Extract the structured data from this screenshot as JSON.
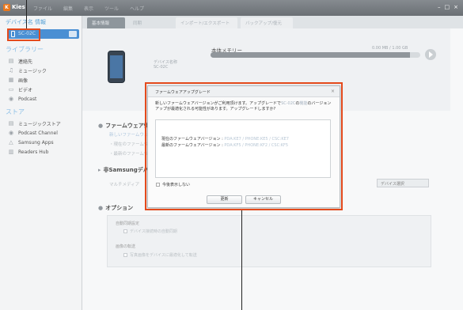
{
  "window": {
    "app_name": "Kies",
    "logo_letter": "K",
    "menu": [
      "ファイル",
      "編集",
      "表示",
      "ツール",
      "ヘルプ"
    ],
    "controls": [
      "–",
      "□",
      "×"
    ]
  },
  "sidebar": {
    "device_header": "デバイス名 情報",
    "device_name": "SC-02C",
    "library_header": "ライブラリー",
    "library_items": [
      {
        "icon": "contacts-icon",
        "glyph": "▤",
        "label": "連絡先"
      },
      {
        "icon": "music-icon",
        "glyph": "♫",
        "label": "ミュージック"
      },
      {
        "icon": "photo-icon",
        "glyph": "▦",
        "label": "画像"
      },
      {
        "icon": "video-icon",
        "glyph": "▭",
        "label": "ビデオ"
      },
      {
        "icon": "podcast-icon",
        "glyph": "◉",
        "label": "Podcast"
      }
    ],
    "store_header": "ストア",
    "store_items": [
      {
        "icon": "music-store-icon",
        "glyph": "▤",
        "label": "ミュージックストア"
      },
      {
        "icon": "podcast-channel-icon",
        "glyph": "◉",
        "label": "Podcast Channel"
      },
      {
        "icon": "samsung-apps-icon",
        "glyph": "△",
        "label": "Samsung Apps"
      },
      {
        "icon": "readers-hub-icon",
        "glyph": "▥",
        "label": "Readers Hub"
      }
    ]
  },
  "tabs": [
    {
      "label": "基本情報",
      "state": "active"
    },
    {
      "label": "同期",
      "state": "normal"
    },
    {
      "label": "インポート/エクスポート",
      "state": "dim"
    },
    {
      "label": "バックアップ/復元",
      "state": "dim"
    }
  ],
  "device_panel": {
    "label_line1": "デバイス名称",
    "label_line2": "SC-02C",
    "storage_title": "本体メモリー",
    "storage_value": "0.00 MB / 1.00 GB",
    "storage_fraction": 0.95
  },
  "firmware_section": {
    "title": "ファームウェア情報",
    "link": "新しいファームウェア",
    "line1": "・現在のファームウェア",
    "line2": "・最新のファームウェア"
  },
  "samsung_section": {
    "title": "非Samsungデバイス",
    "line": "マルチメディア",
    "select_label": "デバイス選択"
  },
  "options_section": {
    "title": "オプション",
    "group1_label": "自動同期設定",
    "group1_check": "デバイス接続時の自動同期",
    "group2_label": "画像の転送",
    "group2_check": "写真画像をデバイスに最適化して転送"
  },
  "dialog": {
    "title": "ファームウェアアップグレード",
    "close": "×",
    "message_part1": "新しいファームウェアバージョンがご利用頂けます。アップグレードで",
    "message_muted1": "SC-02C",
    "message_part2": "の",
    "message_muted2": "機能",
    "message_part3": "のバージョンアップが最適化される可能性があります。アップグレードしますか?",
    "current_label": "現在のファームウェアバージョン :",
    "current_value": "PDA:KE7 / PHONE:KE5 / CSC:KE7",
    "latest_label": "最新のファームウェアバージョン :",
    "latest_value": "PDA:KF5 / PHONE:KF2 / CSC:KF5",
    "checkbox_label": "今後表示しない",
    "update_button": "更新",
    "cancel_button": "キャンセル"
  },
  "colors": {
    "highlight": "#e44a1c",
    "device_tile": "#4a8fd3"
  }
}
